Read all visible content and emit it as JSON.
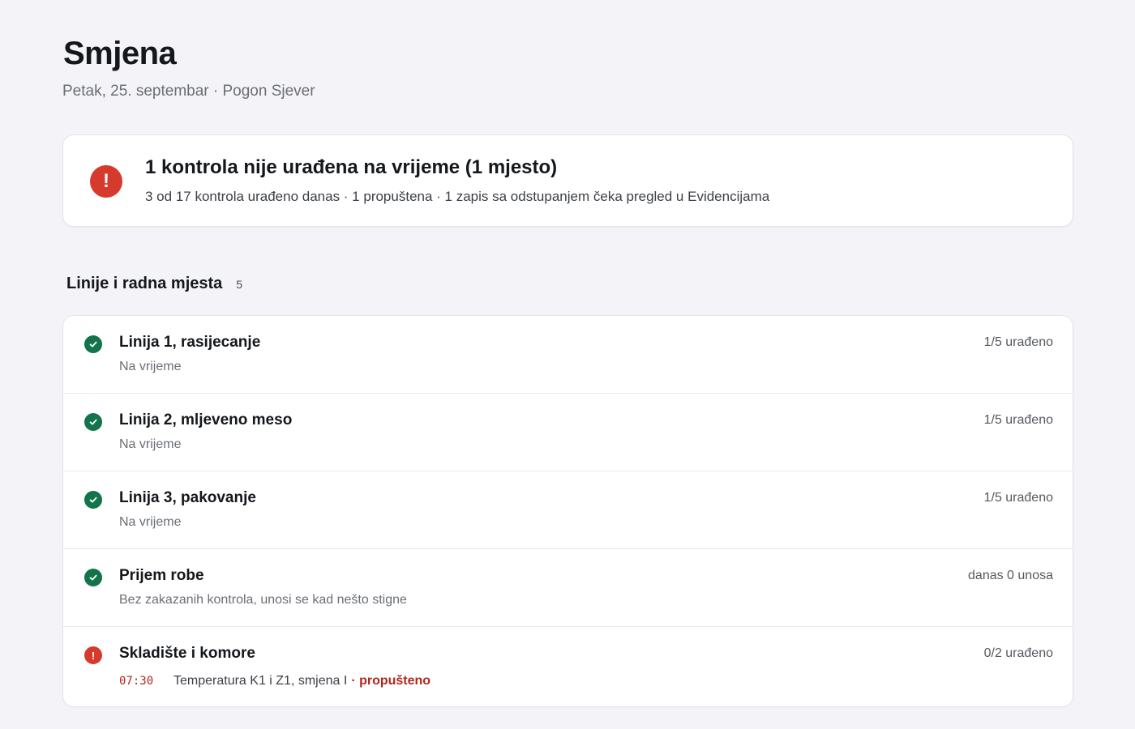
{
  "header": {
    "title": "Smjena",
    "subtitle": "Petak, 25. septembar · Pogon Sjever"
  },
  "alert": {
    "icon": "exclamation-icon",
    "title": "1 kontrola nije urađena na vrijeme (1 mjesto)",
    "text": "3 od 17 kontrola urađeno danas · 1 propuštena · 1 zapis sa odstupanjem čeka pregled u Evidencijama",
    "color": "#d63a2c"
  },
  "section": {
    "title": "Linije i radna mjesta",
    "count": "5"
  },
  "rows": [
    {
      "name": "Linija 1, rasijecanje",
      "sub": "Na vrijeme",
      "status": "1/5 urađeno",
      "icon": "check-circle-icon"
    },
    {
      "name": "Linija 2, mljeveno meso",
      "sub": "Na vrijeme",
      "status": "1/5 urađeno",
      "icon": "check-circle-icon"
    },
    {
      "name": "Linija 3, pakovanje",
      "sub": "Na vrijeme",
      "status": "1/5 urađeno",
      "icon": "check-circle-icon"
    },
    {
      "name": "Prijem robe",
      "sub": "Bez zakazanih kontrola, unosi se kad nešto stigne",
      "status": "danas 0 unosa",
      "icon": "check-circle-icon"
    },
    {
      "name": "Skladište i komore",
      "status": "0/2 urađeno",
      "icon": "exclamation-circle-icon",
      "detail": {
        "time": "07:30",
        "task": "Temperatura K1 i Z1, smjena I",
        "missed": "· propušteno"
      }
    }
  ],
  "colors": {
    "ok": "#13734a",
    "error": "#d63a2c",
    "missed_text": "#b3261e",
    "background": "#f4f4f8"
  }
}
